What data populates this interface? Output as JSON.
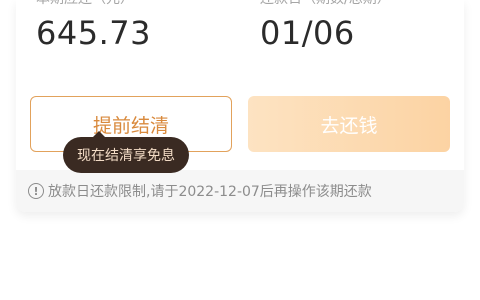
{
  "summary": {
    "left": {
      "label": "本期应还（元）",
      "value": "645.73"
    },
    "right": {
      "label": "还款日（期数/总期）",
      "value": "01/06"
    }
  },
  "buttons": {
    "early_payoff": "提前结清",
    "repay": "去还钱"
  },
  "tooltip": {
    "text": "现在结清享免息"
  },
  "notice": {
    "icon": "info-icon",
    "text": "放款日还款限制,请于2022-12-07后再操作该期还款"
  },
  "colors": {
    "accent": "#d98a3d",
    "repay_gradient_start": "#fde3c2",
    "repay_gradient_end": "#fcd3a3",
    "tooltip_bg": "#3a2a22"
  }
}
